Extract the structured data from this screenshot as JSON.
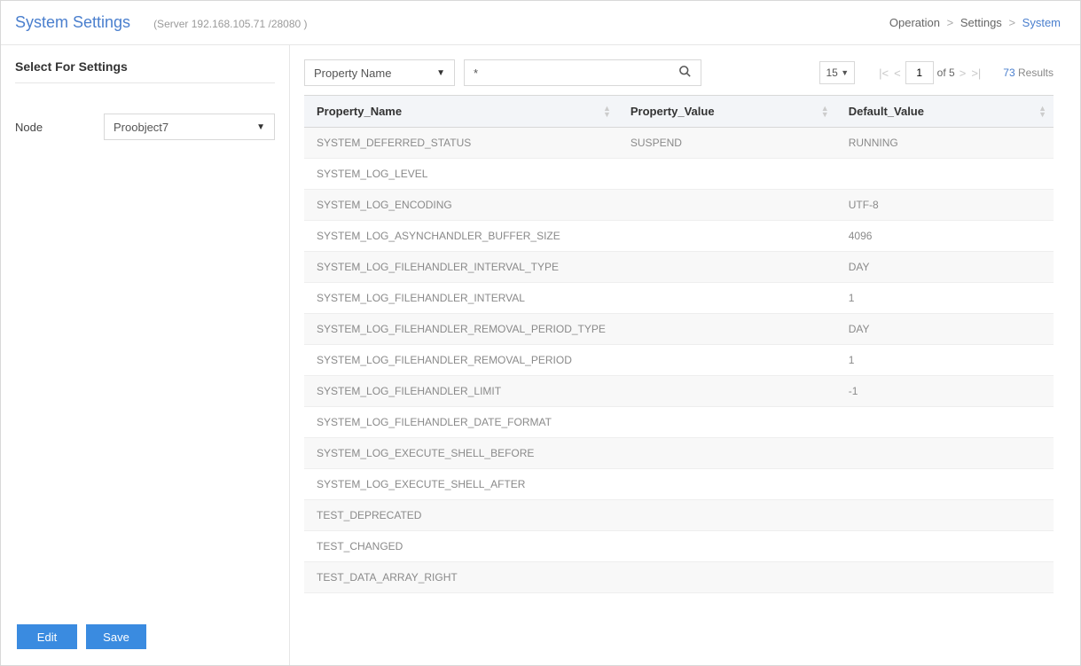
{
  "header": {
    "title": "System Settings",
    "server_info": "(Server 192.168.105.71 /28080 )",
    "breadcrumb": {
      "l1": "Operation",
      "l2": "Settings",
      "l3": "System"
    }
  },
  "sidebar": {
    "title": "Select For Settings",
    "node_label": "Node",
    "node_value": "Proobject7",
    "edit_btn": "Edit",
    "save_btn": "Save"
  },
  "toolbar": {
    "filter_label": "Property Name",
    "search_value": "*",
    "page_size": "15",
    "current_page": "1",
    "of_label": "of",
    "total_pages": "5",
    "result_count": "73",
    "result_label": "Results"
  },
  "table": {
    "headers": {
      "name": "Property_Name",
      "value": "Property_Value",
      "default": "Default_Value"
    },
    "rows": [
      {
        "name": "SYSTEM_DEFERRED_STATUS",
        "value": "SUSPEND",
        "default": "RUNNING"
      },
      {
        "name": "SYSTEM_LOG_LEVEL",
        "value": "",
        "default": ""
      },
      {
        "name": "SYSTEM_LOG_ENCODING",
        "value": "",
        "default": "UTF-8"
      },
      {
        "name": "SYSTEM_LOG_ASYNCHANDLER_BUFFER_SIZE",
        "value": "",
        "default": "4096"
      },
      {
        "name": "SYSTEM_LOG_FILEHANDLER_INTERVAL_TYPE",
        "value": "",
        "default": "DAY"
      },
      {
        "name": "SYSTEM_LOG_FILEHANDLER_INTERVAL",
        "value": "",
        "default": "1"
      },
      {
        "name": "SYSTEM_LOG_FILEHANDLER_REMOVAL_PERIOD_TYPE",
        "value": "",
        "default": "DAY"
      },
      {
        "name": "SYSTEM_LOG_FILEHANDLER_REMOVAL_PERIOD",
        "value": "",
        "default": "1"
      },
      {
        "name": "SYSTEM_LOG_FILEHANDLER_LIMIT",
        "value": "",
        "default": "-1"
      },
      {
        "name": "SYSTEM_LOG_FILEHANDLER_DATE_FORMAT",
        "value": "",
        "default": ""
      },
      {
        "name": "SYSTEM_LOG_EXECUTE_SHELL_BEFORE",
        "value": "",
        "default": ""
      },
      {
        "name": "SYSTEM_LOG_EXECUTE_SHELL_AFTER",
        "value": "",
        "default": ""
      },
      {
        "name": "TEST_DEPRECATED",
        "value": "",
        "default": ""
      },
      {
        "name": "TEST_CHANGED",
        "value": "",
        "default": ""
      },
      {
        "name": "TEST_DATA_ARRAY_RIGHT",
        "value": "",
        "default": ""
      }
    ]
  }
}
